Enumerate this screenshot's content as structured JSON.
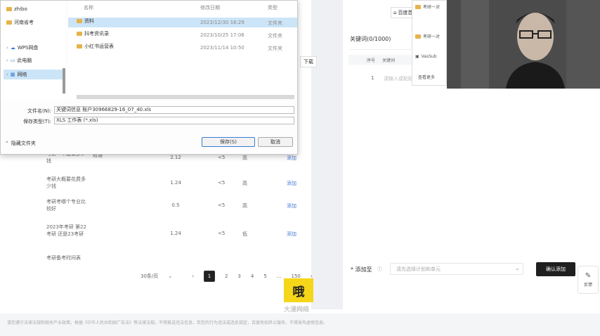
{
  "dialog": {
    "sidebar": [
      {
        "label": "zhibo",
        "icon": "folder-icon"
      },
      {
        "label": "河南省考",
        "icon": "folder-icon"
      },
      {
        "label": "WPS网盘",
        "icon": "cloud-icon"
      },
      {
        "label": "此电脑",
        "icon": "computer-icon"
      },
      {
        "label": "网络",
        "icon": "network-icon"
      }
    ],
    "headers": {
      "name": "名称",
      "date": "修改日期",
      "type": "类型"
    },
    "files": [
      {
        "name": "资料",
        "date": "2023/12/30 16:29",
        "type": "文件夹"
      },
      {
        "name": "抖考资讯录",
        "date": "2023/10/25 17:06",
        "type": "文件夹"
      },
      {
        "name": "小红书运营表",
        "date": "2023/11/14 10:50",
        "type": "文件夹"
      }
    ],
    "filename_label": "文件名(N):",
    "filename_value": "关键词信息 账户30966829-16_07_40.xls",
    "filetype_label": "保存类型(T):",
    "filetype_value": "XLS 工作表 (*.xls)",
    "hide_folders": "隐藏文件夹",
    "save_button": "保存(S)",
    "cancel_button": "取消"
  },
  "table_rows": [
    {
      "keyword": "考研一年能做多少钱",
      "num": "2.12",
      "cmp": "<5",
      "lvl": "高",
      "action": "添加"
    },
    {
      "keyword": "考研大概要花费多少钱",
      "num": "1.24",
      "cmp": "<5",
      "lvl": "高",
      "action": "添加"
    },
    {
      "keyword": "考研考哪个专业比较好",
      "num": "0.5",
      "cmp": "<5",
      "lvl": "高",
      "action": "添加"
    },
    {
      "keyword": "2023年考研 第22考研 还是23考研",
      "num": "1.24",
      "cmp": "<5",
      "lvl": "低",
      "action": "添加"
    },
    {
      "keyword": "考研备考时间表",
      "num": "",
      "cmp": "",
      "lvl": "",
      "action": ""
    }
  ],
  "match_tag": "短语",
  "pager": {
    "size": "30条/页",
    "pages": [
      "1",
      "2",
      "3",
      "4",
      "5",
      "...",
      "150"
    ],
    "current": "1"
  },
  "download_label": "下载",
  "right": {
    "title": "关键词(0/1000)",
    "col_index": "序号",
    "col_keyword": "关键词",
    "row_index": "1",
    "row_placeholder": "请输入或粘贴关键词",
    "home_label": "百度首页"
  },
  "popup": {
    "items": [
      "考研一对",
      "VasSub",
      "查看更多"
    ]
  },
  "bottom": {
    "add_label": "* 添加至",
    "placeholder": "请先选择计划和单元",
    "confirm_button": "确认添加"
  },
  "feedback": "反馈",
  "watermark": {
    "char": "哦",
    "text": "大漫网络"
  },
  "footer_text": "请您遵守法律法规和相关产业政策，根据《中华人民共和国广告法》等法律法规，不得推送违法信息，若您的行为违法或违反规定，百度有权终止服务，不得发布虚假信息。"
}
